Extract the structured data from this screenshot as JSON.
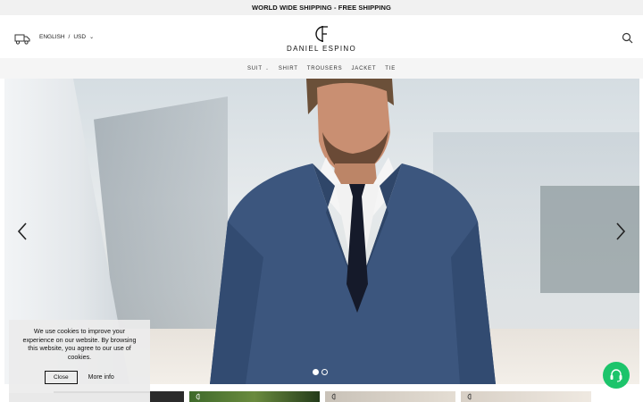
{
  "announcement": "WORLD WIDE SHIPPING - FREE SHIPPING",
  "header": {
    "delivery_icon": "delivery-truck-icon",
    "language": "ENGLISH",
    "separator": "/",
    "currency": "USD",
    "currency_caret": "⌄",
    "brand_name": "DANIEL ESPINO",
    "search_icon": "search-icon"
  },
  "nav": {
    "items": [
      {
        "label": "SUIT",
        "has_dropdown": true
      },
      {
        "label": "SHIRT",
        "has_dropdown": false
      },
      {
        "label": "TROUSERS",
        "has_dropdown": false
      },
      {
        "label": "JACKET",
        "has_dropdown": false
      },
      {
        "label": "TIE",
        "has_dropdown": false
      }
    ],
    "caret": "⌄"
  },
  "slider": {
    "prev_icon": "chevron-left-icon",
    "next_icon": "chevron-right-icon",
    "slide_count": 2,
    "active_slide": 1
  },
  "cookie": {
    "message": "We use cookies to improve your experience on our website. By browsing this website, you agree to our use of cookies.",
    "close_label": "Close",
    "more_label": "More info"
  },
  "chat_icon": "headset-support-icon",
  "colors": {
    "chat": "#1cc46b",
    "topbar": "#f1f1f1",
    "nav_bg": "#f5f5f5"
  }
}
